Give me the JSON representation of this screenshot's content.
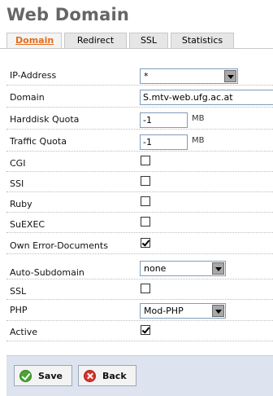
{
  "page": {
    "title": "Web Domain"
  },
  "tabs": [
    {
      "label": "Domain",
      "active": true
    },
    {
      "label": "Redirect",
      "active": false
    },
    {
      "label": "SSL",
      "active": false
    },
    {
      "label": "Statistics",
      "active": false
    }
  ],
  "form": {
    "ip_address": {
      "label": "IP-Address",
      "value": "*"
    },
    "domain": {
      "label": "Domain",
      "value": "S.mtv-web.ufg.ac.at"
    },
    "hd_quota": {
      "label": "Harddisk Quota",
      "value": "-1",
      "unit": "MB"
    },
    "traffic_quota": {
      "label": "Traffic Quota",
      "value": "-1",
      "unit": "MB"
    },
    "cgi": {
      "label": "CGI",
      "checked": false
    },
    "ssi": {
      "label": "SSI",
      "checked": false
    },
    "ruby": {
      "label": "Ruby",
      "checked": false
    },
    "suexec": {
      "label": "SuEXEC",
      "checked": false
    },
    "errordocs": {
      "label": "Own Error-Documents",
      "checked": true
    },
    "subdomain": {
      "label": "Auto-Subdomain",
      "value": "none"
    },
    "ssl": {
      "label": "SSL",
      "checked": false
    },
    "php": {
      "label": "PHP",
      "value": "Mod-PHP"
    },
    "active": {
      "label": "Active",
      "checked": true
    }
  },
  "buttons": {
    "save": "Save",
    "back": "Back"
  },
  "icons": {
    "save": "check-circle-icon",
    "back": "x-circle-icon",
    "dropdown": "chevron-down-icon"
  }
}
